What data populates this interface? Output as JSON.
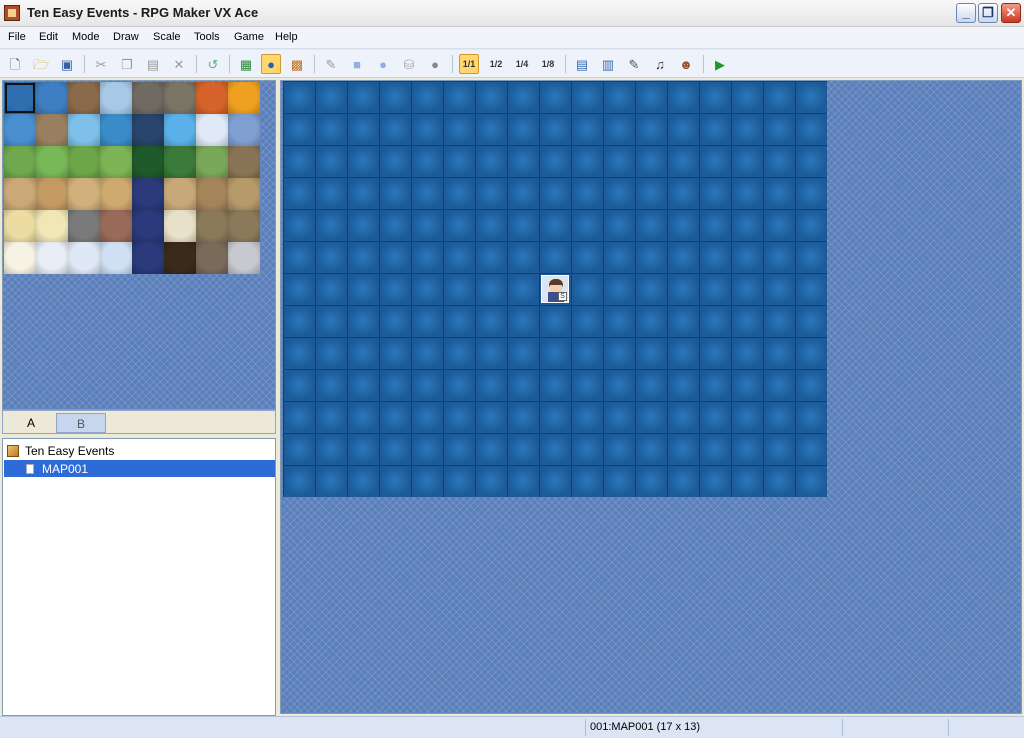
{
  "window": {
    "title": "Ten Easy Events - RPG Maker VX Ace",
    "minimize": "_",
    "restore": "❐",
    "close": "✕"
  },
  "menu": [
    "File",
    "Edit",
    "Mode",
    "Draw",
    "Scale",
    "Tools",
    "Game",
    "Help"
  ],
  "toolbar": {
    "scale_1": "1/1",
    "scale_2": "1/2",
    "scale_4": "1/4",
    "scale_8": "1/8",
    "active_mode": "event",
    "active_scale": "1/1"
  },
  "palette": {
    "tabs": [
      "A",
      "B"
    ],
    "active_tab": "A",
    "tiles": [
      [
        "#2f6fb0",
        "#3d7fc2",
        "#8a6a4a",
        "#a8c8e8",
        "#6f6a62",
        "#7a7466",
        "#d6632a",
        "#f0a020"
      ],
      [
        "#4a8fd0",
        "#9a8060",
        "#7fc0ea",
        "#3a8cc8",
        "#28446a",
        "#5ab0e8",
        "#dfe9f7",
        "#7f9fd0"
      ],
      [
        "#6fa84e",
        "#78b858",
        "#6ca648",
        "#7db456",
        "#1f5a2a",
        "#3a7a3a",
        "#7aa85a",
        "#8a7456"
      ],
      [
        "#caa878",
        "#c49a62",
        "#d2b07c",
        "#cda96e",
        "#2a3a7a",
        "#c8a878",
        "#a6845a",
        "#b69a6a"
      ],
      [
        "#ecdca2",
        "#f0e6b6",
        "#7a7a7a",
        "#9a6a5a",
        "#2a3a7a",
        "#e8e0c8",
        "#8a7a5a",
        "#8a7a5a"
      ],
      [
        "#f6f2e4",
        "#e8eef6",
        "#dfe9f5",
        "#cfe0f4",
        "#2a3a7a",
        "#3a2a1a",
        "#7a6a5a",
        "#c8c8d0"
      ]
    ]
  },
  "tree": {
    "project": "Ten Easy Events",
    "maps": [
      "MAP001"
    ]
  },
  "map": {
    "width_tiles": 17,
    "height_tiles": 13,
    "water_color": "#1e5fa0",
    "player_start": {
      "col": 8,
      "row": 6
    }
  },
  "status": {
    "map_info": "001:MAP001 (17 x 13)"
  }
}
